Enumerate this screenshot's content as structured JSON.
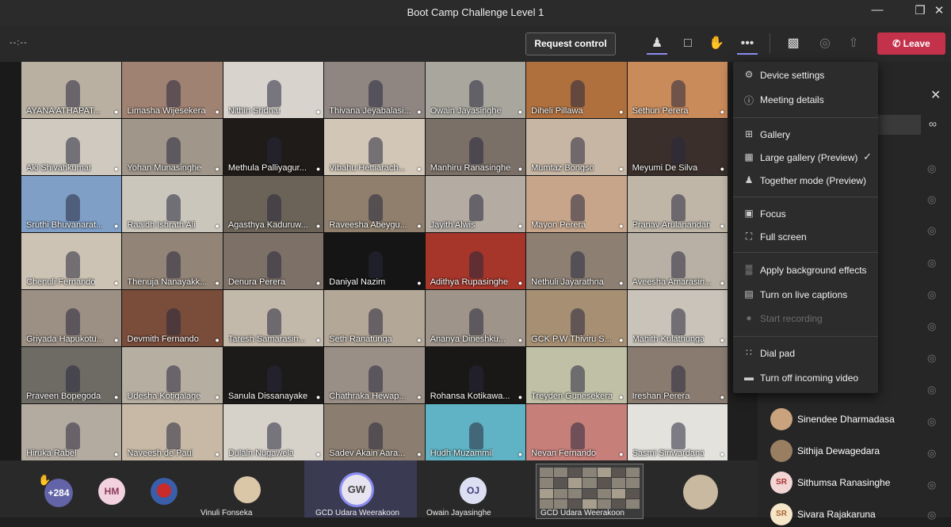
{
  "window": {
    "title": "Boot Camp Challenge Level 1"
  },
  "toolbar": {
    "timer": "--:--",
    "request_control_label": "Request control",
    "leave_label": "Leave"
  },
  "grid": {
    "tiles": [
      {
        "name": "AYANA  ATHAPAT...",
        "bg": "#b9b0a2"
      },
      {
        "name": "Limasha Wijesekera",
        "bg": "#a08272"
      },
      {
        "name": "Nithin Sridhar",
        "bg": "#d8d3cd"
      },
      {
        "name": "Thivana Jeyabalasi...",
        "bg": "#8f8682"
      },
      {
        "name": "Owain Jayasinghe",
        "bg": "#a9a79d"
      },
      {
        "name": "Diheli Pillawa",
        "bg": "#b0703e"
      },
      {
        "name": "Sethun Perera",
        "bg": "#c98b5a"
      },
      {
        "name": "Aki Shivahkumar",
        "bg": "#cfc9c0"
      },
      {
        "name": "Yohan Munasinghe",
        "bg": "#a0968a"
      },
      {
        "name": "Methula Palliyagur...",
        "bg": "#1e1b18"
      },
      {
        "name": "Vibahu Hettiarach...",
        "bg": "#d2c7b7"
      },
      {
        "name": "Manhiru Ranasinghe",
        "bg": "#7b7068"
      },
      {
        "name": "Mumtaz Bongso",
        "bg": "#c7b6a3"
      },
      {
        "name": "Meyumi De Silva",
        "bg": "#3a2f2a"
      },
      {
        "name": "Sruthi Bhuvanarat...",
        "bg": "#7f9fc7"
      },
      {
        "name": "Raaidh Ishrath Ali",
        "bg": "#cbc6bc"
      },
      {
        "name": "Agasthya Kaduruw...",
        "bg": "#6b6357"
      },
      {
        "name": "Raveesha Abeygu...",
        "bg": "#8f7f6c"
      },
      {
        "name": "Jayith Alwis",
        "bg": "#b4aca3"
      },
      {
        "name": "Mayon Perera",
        "bg": "#c7a58a"
      },
      {
        "name": "Pranav Arulanandan",
        "bg": "#bfb6a8"
      },
      {
        "name": "Chenuli Fernando",
        "bg": "#cdc3b4"
      },
      {
        "name": "Thenuja Nanayakk...",
        "bg": "#928476"
      },
      {
        "name": "Denura Perera",
        "bg": "#7d7067"
      },
      {
        "name": "Daniyal Nazim",
        "bg": "#151515"
      },
      {
        "name": "Adithya Rupasinghe",
        "bg": "#a6352a"
      },
      {
        "name": "Nethuli Jayarathna",
        "bg": "#8d8073"
      },
      {
        "name": "Aveesha Amarasin...",
        "bg": "#b8b0a4"
      },
      {
        "name": "Griyada Hapukotu...",
        "bg": "#9c8f83"
      },
      {
        "name": "Devmith Fernando",
        "bg": "#7a4c3a"
      },
      {
        "name": "Taresh  Samarasin...",
        "bg": "#c3b9ab"
      },
      {
        "name": "Seth Ranatunga",
        "bg": "#b3a797"
      },
      {
        "name": "Ananya Dineshku...",
        "bg": "#9e9489"
      },
      {
        "name": "GCK  P.W Thiviru S...",
        "bg": "#a68f73"
      },
      {
        "name": "Mahith Kulathunga",
        "bg": "#c9c3b9"
      },
      {
        "name": "Praveen Bopegoda",
        "bg": "#6e6a64"
      },
      {
        "name": "Udesha Kotigalage",
        "bg": "#b7aea2"
      },
      {
        "name": "Sanula Dissanayake",
        "bg": "#1d1b19"
      },
      {
        "name": "Chathraka Hewap...",
        "bg": "#9a8f86"
      },
      {
        "name": "Rohansa Kotikawa...",
        "bg": "#1a1816"
      },
      {
        "name": "Treyden Gunesekera",
        "bg": "#bfc0a6"
      },
      {
        "name": "Ireshan Perera",
        "bg": "#8a7b70"
      },
      {
        "name": "Hiruka Rabel",
        "bg": "#b3aaa0"
      },
      {
        "name": "Naveesh de Paul",
        "bg": "#c7b9a6"
      },
      {
        "name": "Dulaln  Nugawela",
        "bg": "#d6d1c9"
      },
      {
        "name": "Sadev Akain Aara...",
        "bg": "#8b7d6f"
      },
      {
        "name": "Hudh Muzammil",
        "bg": "#5fb3c4"
      },
      {
        "name": "Nevan Fernando",
        "bg": "#c77f7a"
      },
      {
        "name": "Sasmi Siriwardana",
        "bg": "#e4e2dd"
      }
    ]
  },
  "menu": {
    "device_settings": "Device settings",
    "meeting_details": "Meeting details",
    "gallery": "Gallery",
    "large_gallery": "Large gallery (Preview)",
    "together_mode": "Together mode (Preview)",
    "focus": "Focus",
    "full_screen": "Full screen",
    "apply_background": "Apply background effects",
    "live_captions": "Turn on live captions",
    "start_recording": "Start recording",
    "dial_pad": "Dial pad",
    "incoming_video": "Turn off incoming video"
  },
  "participants": {
    "list": [
      {
        "name": "Sinendee Dharmadasa",
        "initials": "",
        "color": "#c9a27e"
      },
      {
        "name": "Sithija Dewagedara",
        "initials": "",
        "color": "#9a7e62"
      },
      {
        "name": "Sithumsa Ranasinghe",
        "initials": "SR",
        "color": "#f2d5d5"
      },
      {
        "name": "Sivara Rajakaruna",
        "initials": "SR",
        "color": "#f5e6c8"
      }
    ]
  },
  "bottom_bar": {
    "overflow_count": "+284",
    "hm_initials": "HM",
    "vinuli_name": "Vinuli Fonseka",
    "gw_initials": "GW",
    "gw_name": "GCD Udara Weerakoon",
    "oj_initials": "OJ",
    "oj_name": "Owain Jayasinghe",
    "share_name": "GCD Udara Weerakoon"
  }
}
